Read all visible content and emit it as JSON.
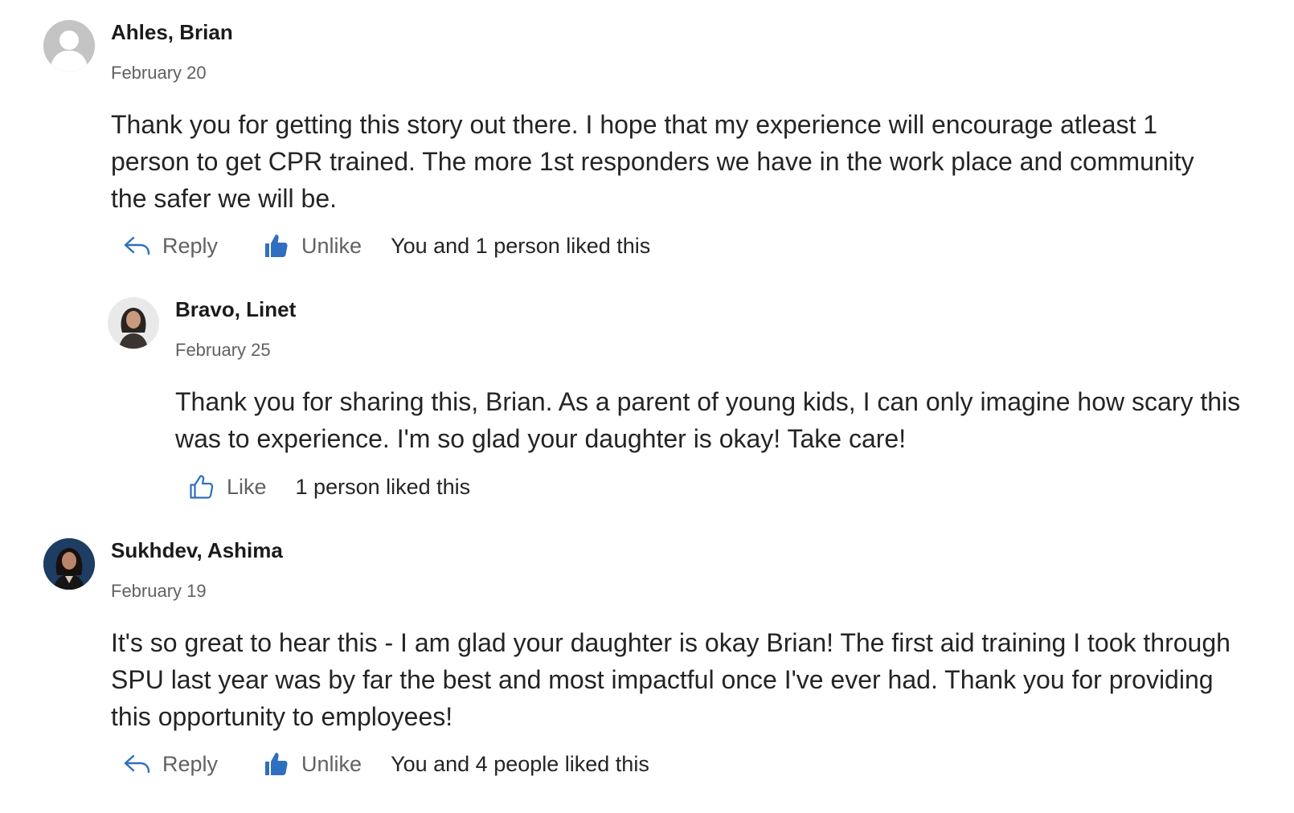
{
  "colors": {
    "accent": "#2f6fbf",
    "muted_text": "#616161",
    "author_text": "#1b1b1b"
  },
  "comments": [
    {
      "author": "Ahles, Brian",
      "date": "February 20",
      "avatar": "default-avatar-icon",
      "text": "Thank you for getting this story out there. I hope that my experience will encourage atleast 1 person to get CPR trained. The more 1st responders we have in the work place and community the safer we will be.",
      "reply_label": "Reply",
      "like_label": "Unlike",
      "liked": true,
      "likes_summary": "You and 1 person liked this"
    },
    {
      "author": "Bravo, Linet",
      "date": "February 25",
      "avatar": "profile-photo",
      "text": "Thank you for sharing this, Brian. As a parent of young kids, I can only imagine how scary this was to experience. I'm so glad your daughter is okay! Take care!",
      "like_label": "Like",
      "liked": false,
      "likes_summary": "1 person liked this"
    },
    {
      "author": "Sukhdev, Ashima",
      "date": "February 19",
      "avatar": "profile-photo",
      "text": "It's so great to hear this - I am glad your daughter is okay Brian! The first aid training I took through SPU last year was by far the best and most impactful once I've ever had. Thank you for providing this opportunity to employees!",
      "reply_label": "Reply",
      "like_label": "Unlike",
      "liked": true,
      "likes_summary": "You and 4 people liked this"
    }
  ]
}
